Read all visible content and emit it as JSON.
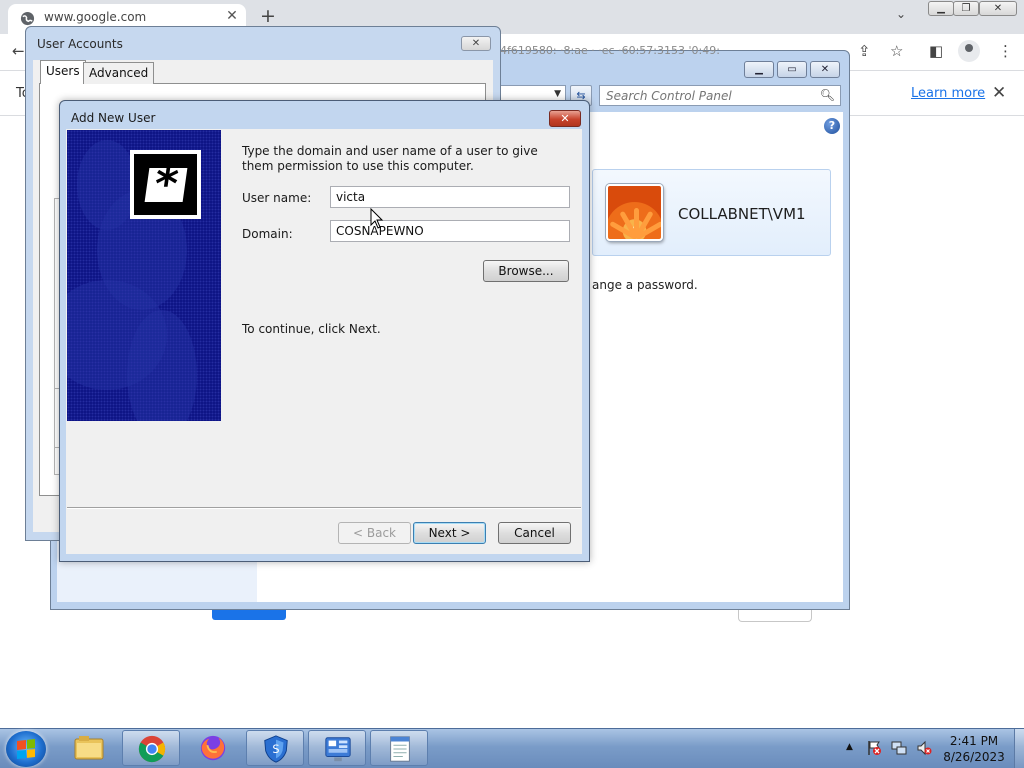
{
  "browser": {
    "tab_title": "www.google.com",
    "tab_close": "✕",
    "new_tab": "+",
    "tab_list": "⌄",
    "window_controls": {
      "minimize": "▁",
      "restore": "❐",
      "close": "✕"
    },
    "toolbar": {
      "back": "←",
      "share": "⇪",
      "bookmark": "☆",
      "sidepanel": "◧",
      "menu": "⋮"
    },
    "infobar": {
      "left_text": "To",
      "link": "Learn more",
      "close": "✕"
    }
  },
  "control_panel": {
    "title_obscured": "4f619580:         ·8:ae ·  ·ec    ·60:57:3153 '0:49:",
    "buttons": {
      "minimize": "▁",
      "maximize": "▭",
      "close": "✕"
    },
    "search_placeholder": "Search Control Panel",
    "user_name": "COLLABNET\\VM1",
    "password_text": "ange a password.",
    "help": "?"
  },
  "user_accounts": {
    "title": "User Accounts",
    "close": "✕",
    "tabs": [
      "Users",
      "Advanced"
    ]
  },
  "add_new_user": {
    "title": "Add New User",
    "close": "✕",
    "instruction": "Type the domain and user name of a user to give them permission to use this computer.",
    "user_name_label": "User name:",
    "user_name_value": "victa",
    "domain_label": "Domain:",
    "domain_value": "COSNAPEWNO",
    "browse": "Browse...",
    "continue_text": "To continue, click Next.",
    "back": "< Back",
    "next": "Next >",
    "cancel": "Cancel"
  },
  "taskbar": {
    "apps": [
      "explorer",
      "chrome",
      "firefox",
      "security-shield",
      "control-panel",
      "notepad"
    ],
    "clock_time": "2:41 PM",
    "clock_date": "8/26/2023",
    "colors": {
      "chrome_red": "#db4437",
      "chrome_green": "#0f9d58",
      "chrome_yellow": "#f4b400",
      "chrome_blue": "#4285f4"
    }
  }
}
